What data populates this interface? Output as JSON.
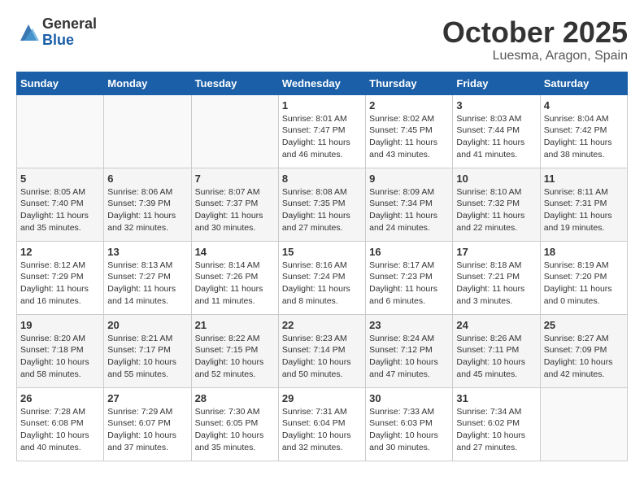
{
  "logo": {
    "general": "General",
    "blue": "Blue"
  },
  "title": "October 2025",
  "location": "Luesma, Aragon, Spain",
  "weekdays": [
    "Sunday",
    "Monday",
    "Tuesday",
    "Wednesday",
    "Thursday",
    "Friday",
    "Saturday"
  ],
  "weeks": [
    [
      {
        "day": "",
        "info": ""
      },
      {
        "day": "",
        "info": ""
      },
      {
        "day": "",
        "info": ""
      },
      {
        "day": "1",
        "info": "Sunrise: 8:01 AM\nSunset: 7:47 PM\nDaylight: 11 hours and 46 minutes."
      },
      {
        "day": "2",
        "info": "Sunrise: 8:02 AM\nSunset: 7:45 PM\nDaylight: 11 hours and 43 minutes."
      },
      {
        "day": "3",
        "info": "Sunrise: 8:03 AM\nSunset: 7:44 PM\nDaylight: 11 hours and 41 minutes."
      },
      {
        "day": "4",
        "info": "Sunrise: 8:04 AM\nSunset: 7:42 PM\nDaylight: 11 hours and 38 minutes."
      }
    ],
    [
      {
        "day": "5",
        "info": "Sunrise: 8:05 AM\nSunset: 7:40 PM\nDaylight: 11 hours and 35 minutes."
      },
      {
        "day": "6",
        "info": "Sunrise: 8:06 AM\nSunset: 7:39 PM\nDaylight: 11 hours and 32 minutes."
      },
      {
        "day": "7",
        "info": "Sunrise: 8:07 AM\nSunset: 7:37 PM\nDaylight: 11 hours and 30 minutes."
      },
      {
        "day": "8",
        "info": "Sunrise: 8:08 AM\nSunset: 7:35 PM\nDaylight: 11 hours and 27 minutes."
      },
      {
        "day": "9",
        "info": "Sunrise: 8:09 AM\nSunset: 7:34 PM\nDaylight: 11 hours and 24 minutes."
      },
      {
        "day": "10",
        "info": "Sunrise: 8:10 AM\nSunset: 7:32 PM\nDaylight: 11 hours and 22 minutes."
      },
      {
        "day": "11",
        "info": "Sunrise: 8:11 AM\nSunset: 7:31 PM\nDaylight: 11 hours and 19 minutes."
      }
    ],
    [
      {
        "day": "12",
        "info": "Sunrise: 8:12 AM\nSunset: 7:29 PM\nDaylight: 11 hours and 16 minutes."
      },
      {
        "day": "13",
        "info": "Sunrise: 8:13 AM\nSunset: 7:27 PM\nDaylight: 11 hours and 14 minutes."
      },
      {
        "day": "14",
        "info": "Sunrise: 8:14 AM\nSunset: 7:26 PM\nDaylight: 11 hours and 11 minutes."
      },
      {
        "day": "15",
        "info": "Sunrise: 8:16 AM\nSunset: 7:24 PM\nDaylight: 11 hours and 8 minutes."
      },
      {
        "day": "16",
        "info": "Sunrise: 8:17 AM\nSunset: 7:23 PM\nDaylight: 11 hours and 6 minutes."
      },
      {
        "day": "17",
        "info": "Sunrise: 8:18 AM\nSunset: 7:21 PM\nDaylight: 11 hours and 3 minutes."
      },
      {
        "day": "18",
        "info": "Sunrise: 8:19 AM\nSunset: 7:20 PM\nDaylight: 11 hours and 0 minutes."
      }
    ],
    [
      {
        "day": "19",
        "info": "Sunrise: 8:20 AM\nSunset: 7:18 PM\nDaylight: 10 hours and 58 minutes."
      },
      {
        "day": "20",
        "info": "Sunrise: 8:21 AM\nSunset: 7:17 PM\nDaylight: 10 hours and 55 minutes."
      },
      {
        "day": "21",
        "info": "Sunrise: 8:22 AM\nSunset: 7:15 PM\nDaylight: 10 hours and 52 minutes."
      },
      {
        "day": "22",
        "info": "Sunrise: 8:23 AM\nSunset: 7:14 PM\nDaylight: 10 hours and 50 minutes."
      },
      {
        "day": "23",
        "info": "Sunrise: 8:24 AM\nSunset: 7:12 PM\nDaylight: 10 hours and 47 minutes."
      },
      {
        "day": "24",
        "info": "Sunrise: 8:26 AM\nSunset: 7:11 PM\nDaylight: 10 hours and 45 minutes."
      },
      {
        "day": "25",
        "info": "Sunrise: 8:27 AM\nSunset: 7:09 PM\nDaylight: 10 hours and 42 minutes."
      }
    ],
    [
      {
        "day": "26",
        "info": "Sunrise: 7:28 AM\nSunset: 6:08 PM\nDaylight: 10 hours and 40 minutes."
      },
      {
        "day": "27",
        "info": "Sunrise: 7:29 AM\nSunset: 6:07 PM\nDaylight: 10 hours and 37 minutes."
      },
      {
        "day": "28",
        "info": "Sunrise: 7:30 AM\nSunset: 6:05 PM\nDaylight: 10 hours and 35 minutes."
      },
      {
        "day": "29",
        "info": "Sunrise: 7:31 AM\nSunset: 6:04 PM\nDaylight: 10 hours and 32 minutes."
      },
      {
        "day": "30",
        "info": "Sunrise: 7:33 AM\nSunset: 6:03 PM\nDaylight: 10 hours and 30 minutes."
      },
      {
        "day": "31",
        "info": "Sunrise: 7:34 AM\nSunset: 6:02 PM\nDaylight: 10 hours and 27 minutes."
      },
      {
        "day": "",
        "info": ""
      }
    ]
  ]
}
